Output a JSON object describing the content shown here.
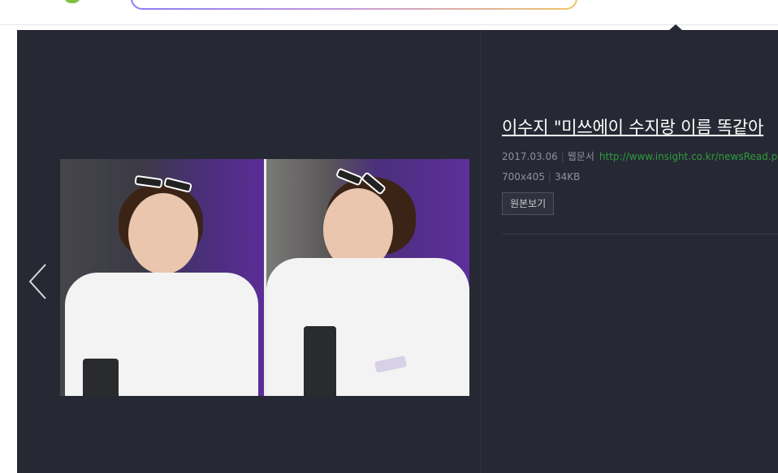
{
  "viewer": {
    "title": "이수지 \"미쓰에이 수지랑 이름 똑같아",
    "date": "2017.03.06",
    "source_type": "웹문서",
    "source_url": "http://www.insight.co.kr/newsRead.php?A",
    "dimensions": "700x405",
    "file_size": "34KB",
    "original_button": "원본보기"
  },
  "colors": {
    "viewer_bg": "#262933",
    "url_green": "#2f9a3f",
    "meta_gray": "#8d9099"
  },
  "icons": {
    "prev": "chevron-left-icon"
  }
}
